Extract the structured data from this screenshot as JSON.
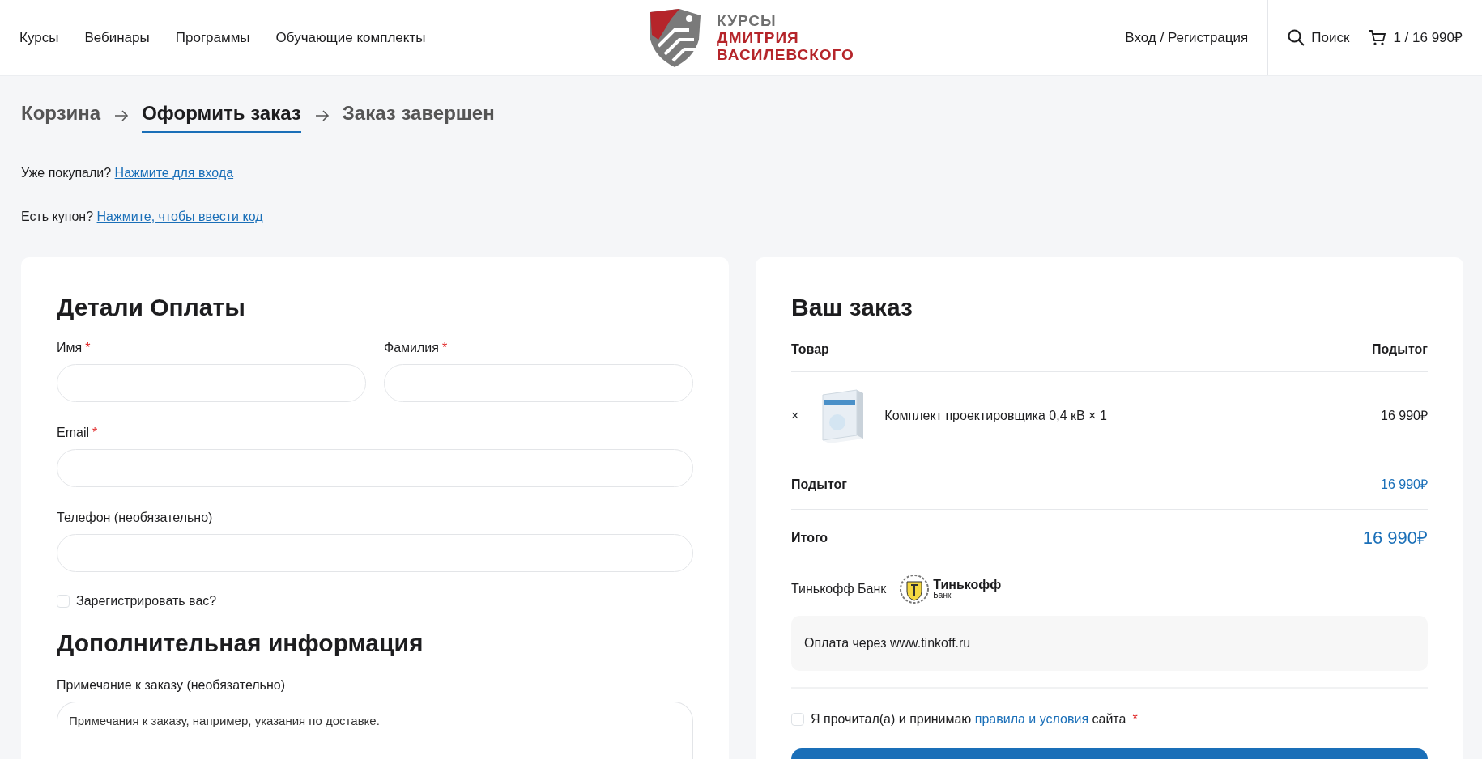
{
  "nav": {
    "links": [
      {
        "label": "Курсы"
      },
      {
        "label": "Вебинары"
      },
      {
        "label": "Программы"
      },
      {
        "label": "Обучающие комплекты"
      }
    ]
  },
  "logo": {
    "lines": [
      "КУРСЫ",
      "ДМИТРИЯ",
      "ВАСИЛЕВСКОГО"
    ]
  },
  "account": {
    "login": "Вход / Регистрация",
    "search": "Поиск",
    "cart": "1 / 16 990₽"
  },
  "steps": [
    {
      "label": "Корзина",
      "selected": false
    },
    {
      "label": "Оформить заказ",
      "selected": true
    },
    {
      "label": "Заказ завершен",
      "selected": false
    }
  ],
  "notices": [
    {
      "text": "Уже покупали?",
      "link": "Нажмите для входа"
    },
    {
      "text": "Есть купон?",
      "link": "Нажмите, чтобы ввести код"
    }
  ],
  "required_mark": "*",
  "billing": {
    "title": "Детали Оплаты",
    "rows": [
      [
        {
          "label": "Имя",
          "required": true
        },
        {
          "label": "Фамилия",
          "required": true
        }
      ],
      [
        {
          "label": "Email",
          "required": true
        }
      ],
      [
        {
          "label": "Телефон (необязательно)",
          "required": false
        }
      ]
    ],
    "register": {
      "label": "Зарегистрировать вас?",
      "checked": false
    }
  },
  "additional": {
    "title": "Дополнительная информация",
    "note_label": "Примечание к заказу (необязательно)",
    "note_placeholder": "Примечания к заказу, например, указания по доставке."
  },
  "order": {
    "title": "Ваш заказ",
    "columns": [
      "Товар",
      "Подытог"
    ],
    "items": [
      {
        "remove": "×",
        "name": "Комплект проектировщика 0,4 кВ × 1",
        "price": "16 990₽"
      }
    ],
    "subtotal": {
      "label": "Подытог",
      "value": "16 990₽"
    },
    "total": {
      "label": "Итого",
      "value": "16 990₽"
    },
    "payment": {
      "name": "Тинькофф Банк",
      "logo_name": "Тинькофф",
      "logo_sub": "Банк",
      "description": "Оплата через www.tinkoff.ru"
    },
    "terms": {
      "checked": false,
      "before": "Я прочитал(а) и принимаю",
      "link": "правила и условия",
      "after": "сайта",
      "required": true
    }
  }
}
